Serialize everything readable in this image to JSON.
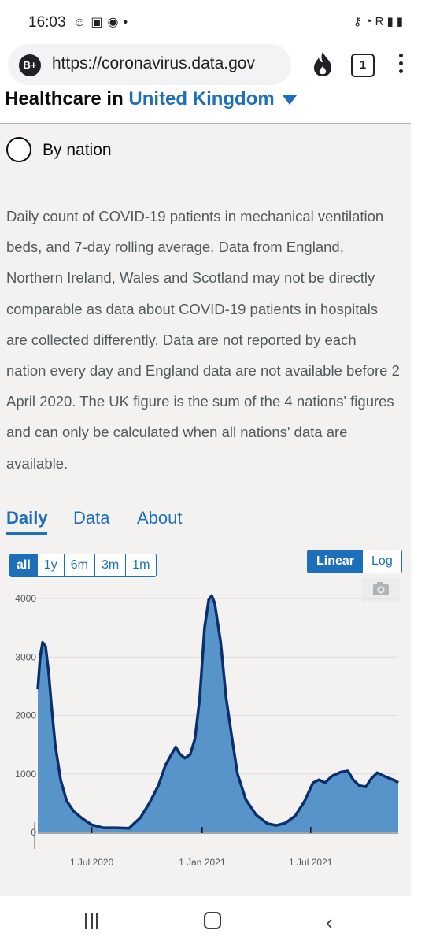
{
  "status_bar": {
    "time": "16:03",
    "left_icons": [
      "face-icon",
      "image-icon",
      "signal-icon"
    ],
    "right_icons": [
      "key-icon",
      "wifi-icon",
      "signal-bars-icon",
      "battery-icon"
    ],
    "roaming_letter": "R"
  },
  "browser": {
    "site_badge": "B+",
    "url": "https://coronavirus.data.gov",
    "tab_count": "1"
  },
  "page": {
    "heading_prefix": "Healthcare in",
    "heading_area": "United Kingdom",
    "radio_label": "By nation",
    "description": "Daily count of COVID-19 patients in mechanical ventilation beds, and 7-day rolling average. Data from England, Northern Ireland, Wales and Scotland may not be directly comparable as data about COVID-19 patients in hospitals are collected differently. Data are not reported by each nation every day and England data are not available before 2 April 2020. The UK figure is the sum of the 4 nations' figures and can only be calculated when all nations' data are available.",
    "tabs": [
      {
        "label": "Daily",
        "active": true
      },
      {
        "label": "Data",
        "active": false
      },
      {
        "label": "About",
        "active": false
      }
    ],
    "ranges": [
      {
        "label": "all",
        "active": true
      },
      {
        "label": "1y",
        "active": false
      },
      {
        "label": "6m",
        "active": false
      },
      {
        "label": "3m",
        "active": false
      },
      {
        "label": "1m",
        "active": false
      }
    ],
    "scales": [
      {
        "label": "Linear",
        "active": true
      },
      {
        "label": "Log",
        "active": false
      }
    ]
  },
  "chart_data": {
    "type": "area",
    "title": "",
    "xlabel": "",
    "ylabel": "",
    "ylim": [
      0,
      4000
    ],
    "y_ticks": [
      "0",
      "1000",
      "2000",
      "3000",
      "4000"
    ],
    "x_ticks": [
      "1 Jul 2020",
      "1 Jan 2021",
      "1 Jul 2021"
    ],
    "x_tick_dates": [
      "2020-07-01",
      "2021-01-01",
      "2021-07-01"
    ],
    "x_range": [
      "2020-04-02",
      "2021-11-24"
    ],
    "colors": {
      "area": "#5694ca",
      "line": "#0b2f6b",
      "axis": "#505a5f"
    },
    "grid": true,
    "series": [
      {
        "x": [
          "2020-04-02",
          "2020-04-06",
          "2020-04-10",
          "2020-04-15",
          "2020-04-20",
          "2020-04-25",
          "2020-05-01",
          "2020-05-10",
          "2020-05-20",
          "2020-06-01",
          "2020-06-15",
          "2020-07-01",
          "2020-07-20",
          "2020-08-10",
          "2020-09-01",
          "2020-09-20",
          "2020-10-05",
          "2020-10-20",
          "2020-11-01",
          "2020-11-10",
          "2020-11-18",
          "2020-11-25",
          "2020-12-03",
          "2020-12-12",
          "2020-12-20",
          "2020-12-28",
          "2021-01-05",
          "2021-01-12",
          "2021-01-17",
          "2021-01-22",
          "2021-02-01",
          "2021-02-10",
          "2021-02-20",
          "2021-03-01",
          "2021-03-15",
          "2021-04-01",
          "2021-04-20",
          "2021-05-05",
          "2021-05-20",
          "2021-06-05",
          "2021-06-20",
          "2021-07-05",
          "2021-07-15",
          "2021-07-25",
          "2021-08-05",
          "2021-08-20",
          "2021-09-01",
          "2021-09-10",
          "2021-09-20",
          "2021-10-01",
          "2021-10-10",
          "2021-10-20",
          "2021-11-01",
          "2021-11-10",
          "2021-11-18",
          "2021-11-24"
        ],
        "values": [
          2450,
          3000,
          3250,
          3180,
          2750,
          2150,
          1500,
          900,
          540,
          360,
          240,
          130,
          80,
          80,
          70,
          250,
          500,
          800,
          1150,
          1320,
          1460,
          1340,
          1270,
          1330,
          1600,
          2300,
          3500,
          3980,
          4050,
          3920,
          3250,
          2300,
          1600,
          1000,
          560,
          300,
          150,
          120,
          160,
          280,
          520,
          850,
          900,
          850,
          960,
          1030,
          1050,
          900,
          800,
          780,
          920,
          1020,
          960,
          920,
          890,
          850
        ]
      }
    ]
  }
}
